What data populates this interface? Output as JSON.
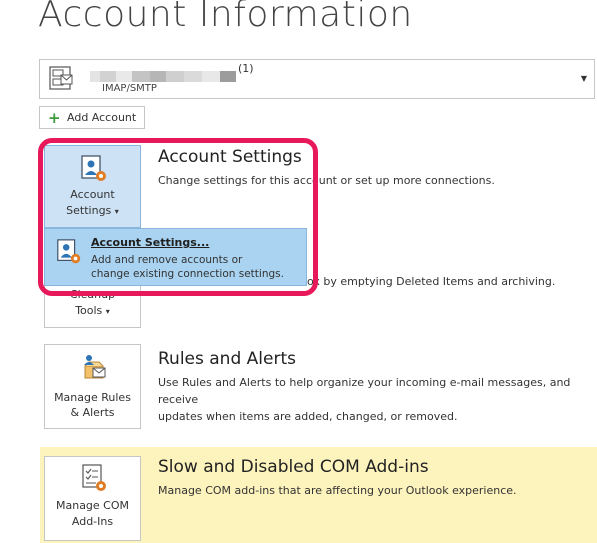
{
  "page": {
    "title": "Account Information"
  },
  "account": {
    "count": "(1)",
    "type": "IMAP/SMTP"
  },
  "add_account": {
    "label": "Add Account"
  },
  "account_settings": {
    "button_label_1": "Account",
    "button_label_2": "Settings",
    "title": "Account Settings",
    "description": "Change settings for this account or set up more connections."
  },
  "popup": {
    "title": "Account Settings...",
    "desc_line1": "Add and remove accounts or",
    "desc_line2": "change existing connection settings."
  },
  "tools": {
    "button_label_1": "Cleanup",
    "button_label_2": "Tools",
    "description_tail": "ox by emptying Deleted Items and archiving."
  },
  "rules": {
    "button_label_1": "Manage Rules",
    "button_label_2": "& Alerts",
    "title": "Rules and Alerts",
    "description_line1": "Use Rules and Alerts to help organize your incoming e-mail messages, and receive",
    "description_line2": "updates when items are added, changed, or removed."
  },
  "addins": {
    "button_label_1": "Manage COM",
    "button_label_2": "Add-Ins",
    "title": "Slow and Disabled COM Add-ins",
    "description": "Manage COM add-ins that are affecting your Outlook experience."
  },
  "colors": {
    "accent_blue": "#cde3f5",
    "popup_blue": "#a9d3f0",
    "highlight_red": "#e8195a",
    "warning_yellow": "#fdf3bd"
  }
}
